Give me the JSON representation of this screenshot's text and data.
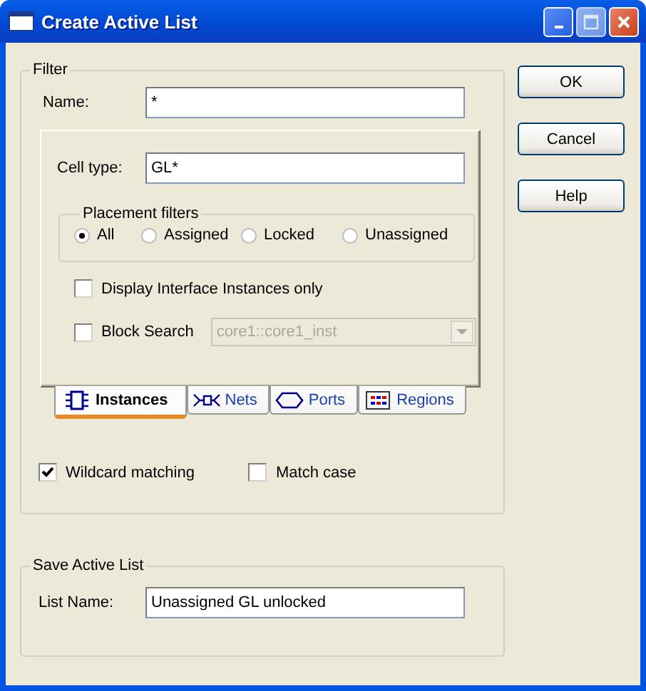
{
  "window": {
    "title": "Create Active List"
  },
  "filter": {
    "legend": "Filter",
    "name_label": "Name:",
    "name_value": "*",
    "cell_type_label": "Cell type:",
    "cell_type_value": "GL*",
    "placement": {
      "legend": "Placement filters",
      "options": [
        {
          "label": "All",
          "selected": true
        },
        {
          "label": "Assigned",
          "selected": false
        },
        {
          "label": "Locked",
          "selected": false
        },
        {
          "label": "Unassigned",
          "selected": false
        }
      ]
    },
    "interface_only": {
      "label": "Display Interface Instances only",
      "checked": false
    },
    "block_search": {
      "label": "Block Search",
      "checked": false,
      "combo_value": "core1::core1_inst",
      "combo_disabled": true
    },
    "tabs": [
      {
        "label": "Instances",
        "kind": "instances",
        "selected": true
      },
      {
        "label": "Nets",
        "kind": "nets",
        "selected": false
      },
      {
        "label": "Ports",
        "kind": "ports",
        "selected": false
      },
      {
        "label": "Regions",
        "kind": "regions",
        "selected": false
      }
    ],
    "options": [
      {
        "label": "Wildcard matching",
        "checked": true
      },
      {
        "label": "Match case",
        "checked": false
      }
    ]
  },
  "save": {
    "legend": "Save Active List",
    "list_name_label": "List Name:",
    "list_name_value": "Unassigned GL unlocked"
  },
  "buttons": [
    "OK",
    "Cancel",
    "Help"
  ]
}
